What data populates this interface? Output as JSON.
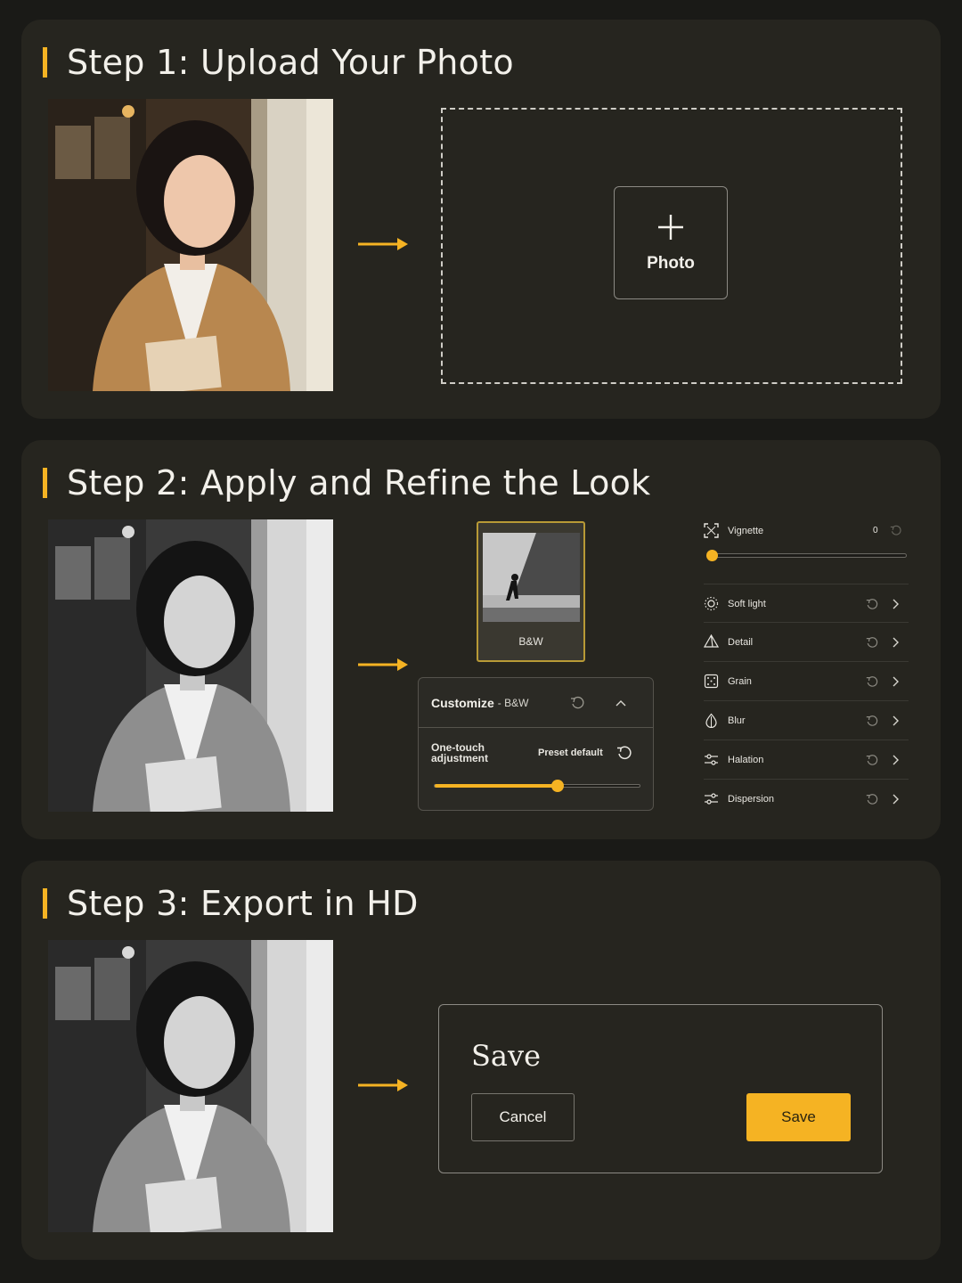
{
  "step1": {
    "title": "Step 1: Upload Your Photo",
    "add_photo_label": "Photo",
    "photo_icon": "plus-icon"
  },
  "step2": {
    "title": "Step 2: Apply and Refine the Look",
    "preset": {
      "label": "B&W"
    },
    "customize": {
      "title": "Customize",
      "subtitle": "- B&W",
      "one_touch_label": "One-touch adjustment",
      "preset_default_label": "Preset default",
      "slider_value": 0.6
    },
    "adjustments": {
      "vignette": {
        "label": "Vignette",
        "value": "0",
        "slider_value": 0
      },
      "items": [
        {
          "label": "Soft light",
          "icon": "sun-icon"
        },
        {
          "label": "Detail",
          "icon": "pyramid-icon"
        },
        {
          "label": "Grain",
          "icon": "grain-icon"
        },
        {
          "label": "Blur",
          "icon": "drop-icon"
        },
        {
          "label": "Halation",
          "icon": "sliders-icon"
        },
        {
          "label": "Dispersion",
          "icon": "sliders-icon"
        }
      ]
    }
  },
  "step3": {
    "title": "Step 3: Export in HD",
    "dialog": {
      "title": "Save",
      "cancel_label": "Cancel",
      "save_label": "Save"
    }
  },
  "colors": {
    "accent": "#f5b323",
    "background": "#1a1a17",
    "card": "#26251f"
  }
}
